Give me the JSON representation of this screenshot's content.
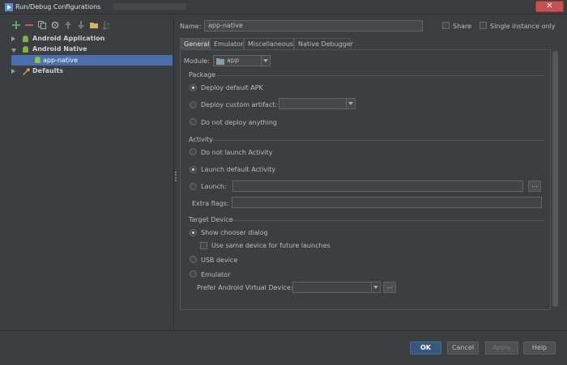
{
  "window": {
    "title": "Run/Debug Configurations",
    "close_glyph": "✕"
  },
  "toolbar": [
    "add-icon",
    "remove-icon",
    "copy-icon",
    "settings-icon",
    "move-up-icon",
    "move-down-icon",
    "folder-icon",
    "sort-icon"
  ],
  "tree": {
    "items": [
      {
        "label": "Android Application",
        "expanded": false
      },
      {
        "label": "Android Native",
        "expanded": true
      },
      {
        "label": "app-native",
        "selected": true
      },
      {
        "label": "Defaults",
        "expanded": false
      }
    ]
  },
  "form": {
    "name_label": "Name:",
    "name_value": "app-native",
    "share_label": "Share",
    "single_instance_label": "Single instance only"
  },
  "tabs": [
    "General",
    "Emulator",
    "Miscellaneous",
    "Native Debugger"
  ],
  "general": {
    "module_label": "Module:",
    "module_value": "app",
    "package": {
      "title": "Package",
      "options": [
        "Deploy default APK",
        "Deploy custom artifact:",
        "Do not deploy anything"
      ]
    },
    "activity": {
      "title": "Activity",
      "options": [
        "Do not launch Activity",
        "Launch default Activity",
        "Launch:"
      ],
      "extra_flags_label": "Extra flags:"
    },
    "target": {
      "title": "Target Device",
      "show_chooser": "Show chooser dialog",
      "same_device": "Use same device for future launches",
      "usb": "USB device",
      "emulator": "Emulator",
      "prefer_avd": "Prefer Android Virtual Device:"
    },
    "browse_label": "..."
  },
  "buttons": {
    "ok": "OK",
    "cancel": "Cancel",
    "apply": "Apply",
    "help": "Help"
  },
  "colors": {
    "background": "#3c3f41",
    "selection": "#4b6eaf",
    "close": "#c75050",
    "primary": "#365880"
  }
}
